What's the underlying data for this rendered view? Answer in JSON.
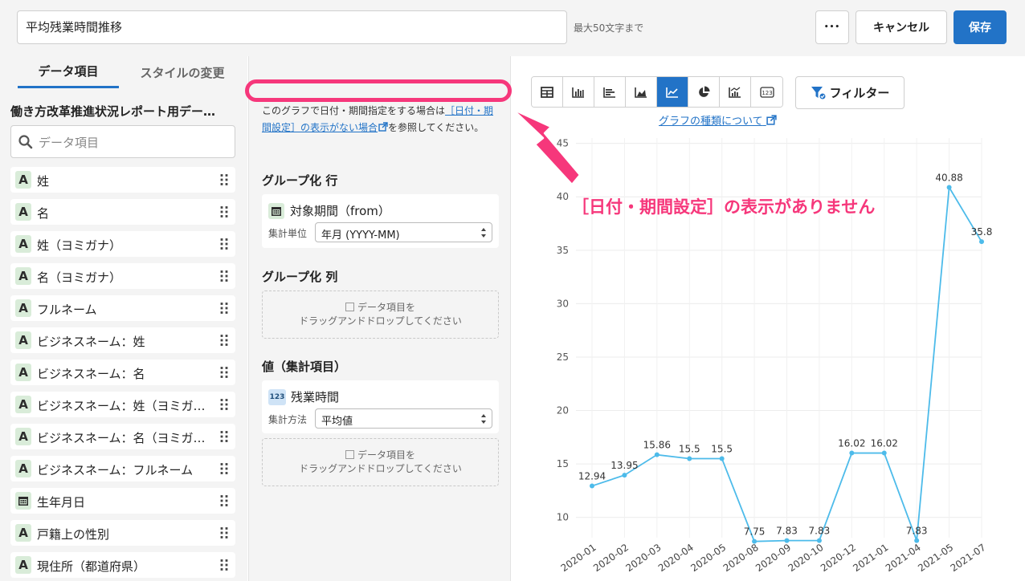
{
  "header": {
    "title_value": "平均残業時間推移",
    "title_hint": "最大50文字まで",
    "more_label": "•••",
    "cancel_label": "キャンセル",
    "save_label": "保存"
  },
  "left": {
    "tabs": [
      {
        "label": "データ項目"
      },
      {
        "label": "スタイルの変更"
      }
    ],
    "dataset_title": "働き方改革推進状況レポート用デー…",
    "search_placeholder": "データ項目",
    "fields": [
      {
        "type": "A",
        "label": "姓"
      },
      {
        "type": "A",
        "label": "名"
      },
      {
        "type": "A",
        "label": "姓（ヨミガナ）"
      },
      {
        "type": "A",
        "label": "名（ヨミガナ）"
      },
      {
        "type": "A",
        "label": "フルネーム"
      },
      {
        "type": "A",
        "label": "ビジネスネーム：姓"
      },
      {
        "type": "A",
        "label": "ビジネスネーム：名"
      },
      {
        "type": "A",
        "label": "ビジネスネーム：姓（ヨミガ…"
      },
      {
        "type": "A",
        "label": "ビジネスネーム：名（ヨミガ…"
      },
      {
        "type": "A",
        "label": "ビジネスネーム：フルネーム"
      },
      {
        "type": "date",
        "label": "生年月日"
      },
      {
        "type": "A",
        "label": "戸籍上の性別"
      },
      {
        "type": "A",
        "label": "現住所（都道府県）"
      }
    ]
  },
  "middle": {
    "note_pre": "このグラフで日付・期間指定をする場合は",
    "note_link": "［日付・期間設定］の表示がない場合",
    "note_post": "を参照してください。",
    "group_row_title": "グループ化 行",
    "group_row_field": "対象期間（from）",
    "group_row_unit_label": "集計単位",
    "group_row_unit_value": "年月 (YYYY-MM)",
    "group_col_title": "グループ化 列",
    "drop_line1": "データ項目を",
    "drop_line2": "ドラッグアンドドロップしてください",
    "value_title": "値（集計項目）",
    "value_field_badge": "123",
    "value_field": "残業時間",
    "value_method_label": "集計方法",
    "value_method_value": "平均値"
  },
  "right": {
    "chart_types": [
      "table-icon",
      "bar-icon",
      "horizontal-bar-icon",
      "area-icon",
      "line-icon",
      "pie-icon",
      "combo-icon",
      "number-icon"
    ],
    "active_chart_type": "line-icon",
    "filter_label": "フィルター",
    "about_link": "グラフの種類について"
  },
  "annotation": {
    "text": "［日付・期間設定］の表示がありません",
    "color": "#f6377b"
  },
  "colors": {
    "accent": "#2273c7",
    "line": "#4dbbea",
    "highlight": "#f6377b"
  },
  "chart_data": {
    "type": "line",
    "categories": [
      "2020-01",
      "2020-02",
      "2020-03",
      "2020-04",
      "2020-05",
      "2020-08",
      "2020-09",
      "2020-10",
      "2020-12",
      "2021-01",
      "2021-04",
      "2021-05",
      "2021-07"
    ],
    "values": [
      12.94,
      13.95,
      15.86,
      15.5,
      15.5,
      7.75,
      7.83,
      7.83,
      16.02,
      16.02,
      7.83,
      40.88,
      35.8
    ],
    "data_labels": [
      "12.94",
      "13.95",
      "15.86",
      "15.5",
      "15.5",
      "7.75",
      "7.83",
      "7.83",
      "16.02",
      "16.02",
      "7.83",
      "40.88",
      "35.8"
    ],
    "yticks": [
      "10",
      "15",
      "20",
      "25",
      "30",
      "35",
      "40",
      "45"
    ],
    "ylim": [
      8.1,
      45.5
    ],
    "grid": true,
    "title": "",
    "xlabel": "",
    "ylabel": ""
  }
}
